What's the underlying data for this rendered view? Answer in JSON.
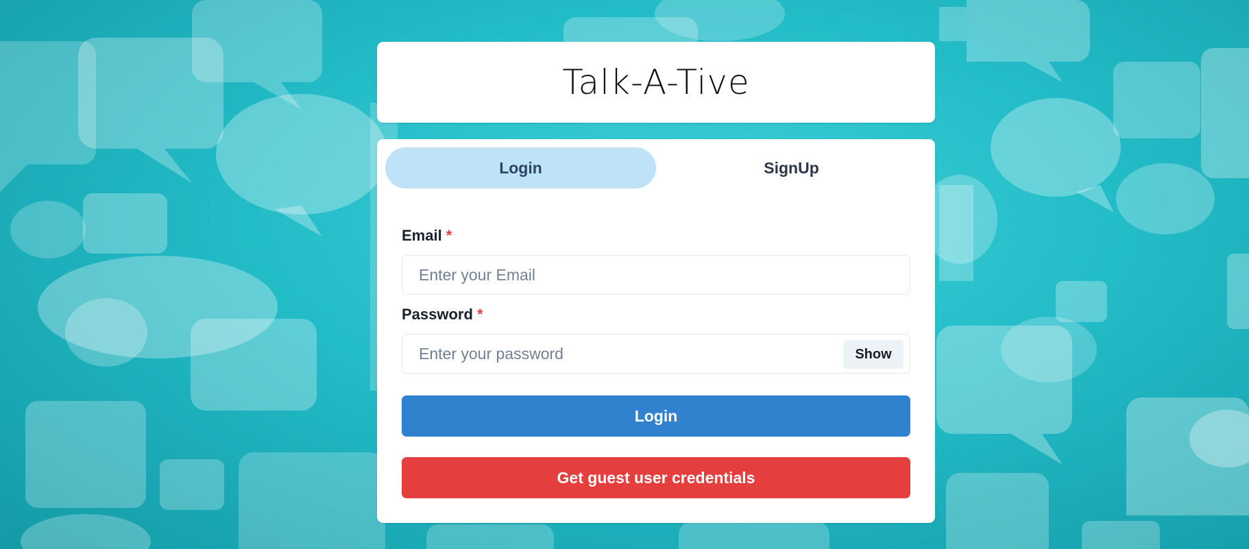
{
  "app": {
    "title": "Talk-A-Tive"
  },
  "tabs": [
    {
      "label": "Login",
      "active": true
    },
    {
      "label": "SignUp",
      "active": false
    }
  ],
  "form": {
    "email": {
      "label": "Email",
      "required_mark": "*",
      "value": "",
      "placeholder": "Enter your Email"
    },
    "password": {
      "label": "Password",
      "required_mark": "*",
      "value": "",
      "placeholder": "Enter your password",
      "toggle_label": "Show"
    },
    "login_button": "Login",
    "guest_button": "Get guest user credentials"
  },
  "colors": {
    "background": "#22bcc7",
    "active_tab": "#bee3f8",
    "login_button": "#3182ce",
    "guest_button": "#e53e3e",
    "required": "#e53e3e"
  }
}
